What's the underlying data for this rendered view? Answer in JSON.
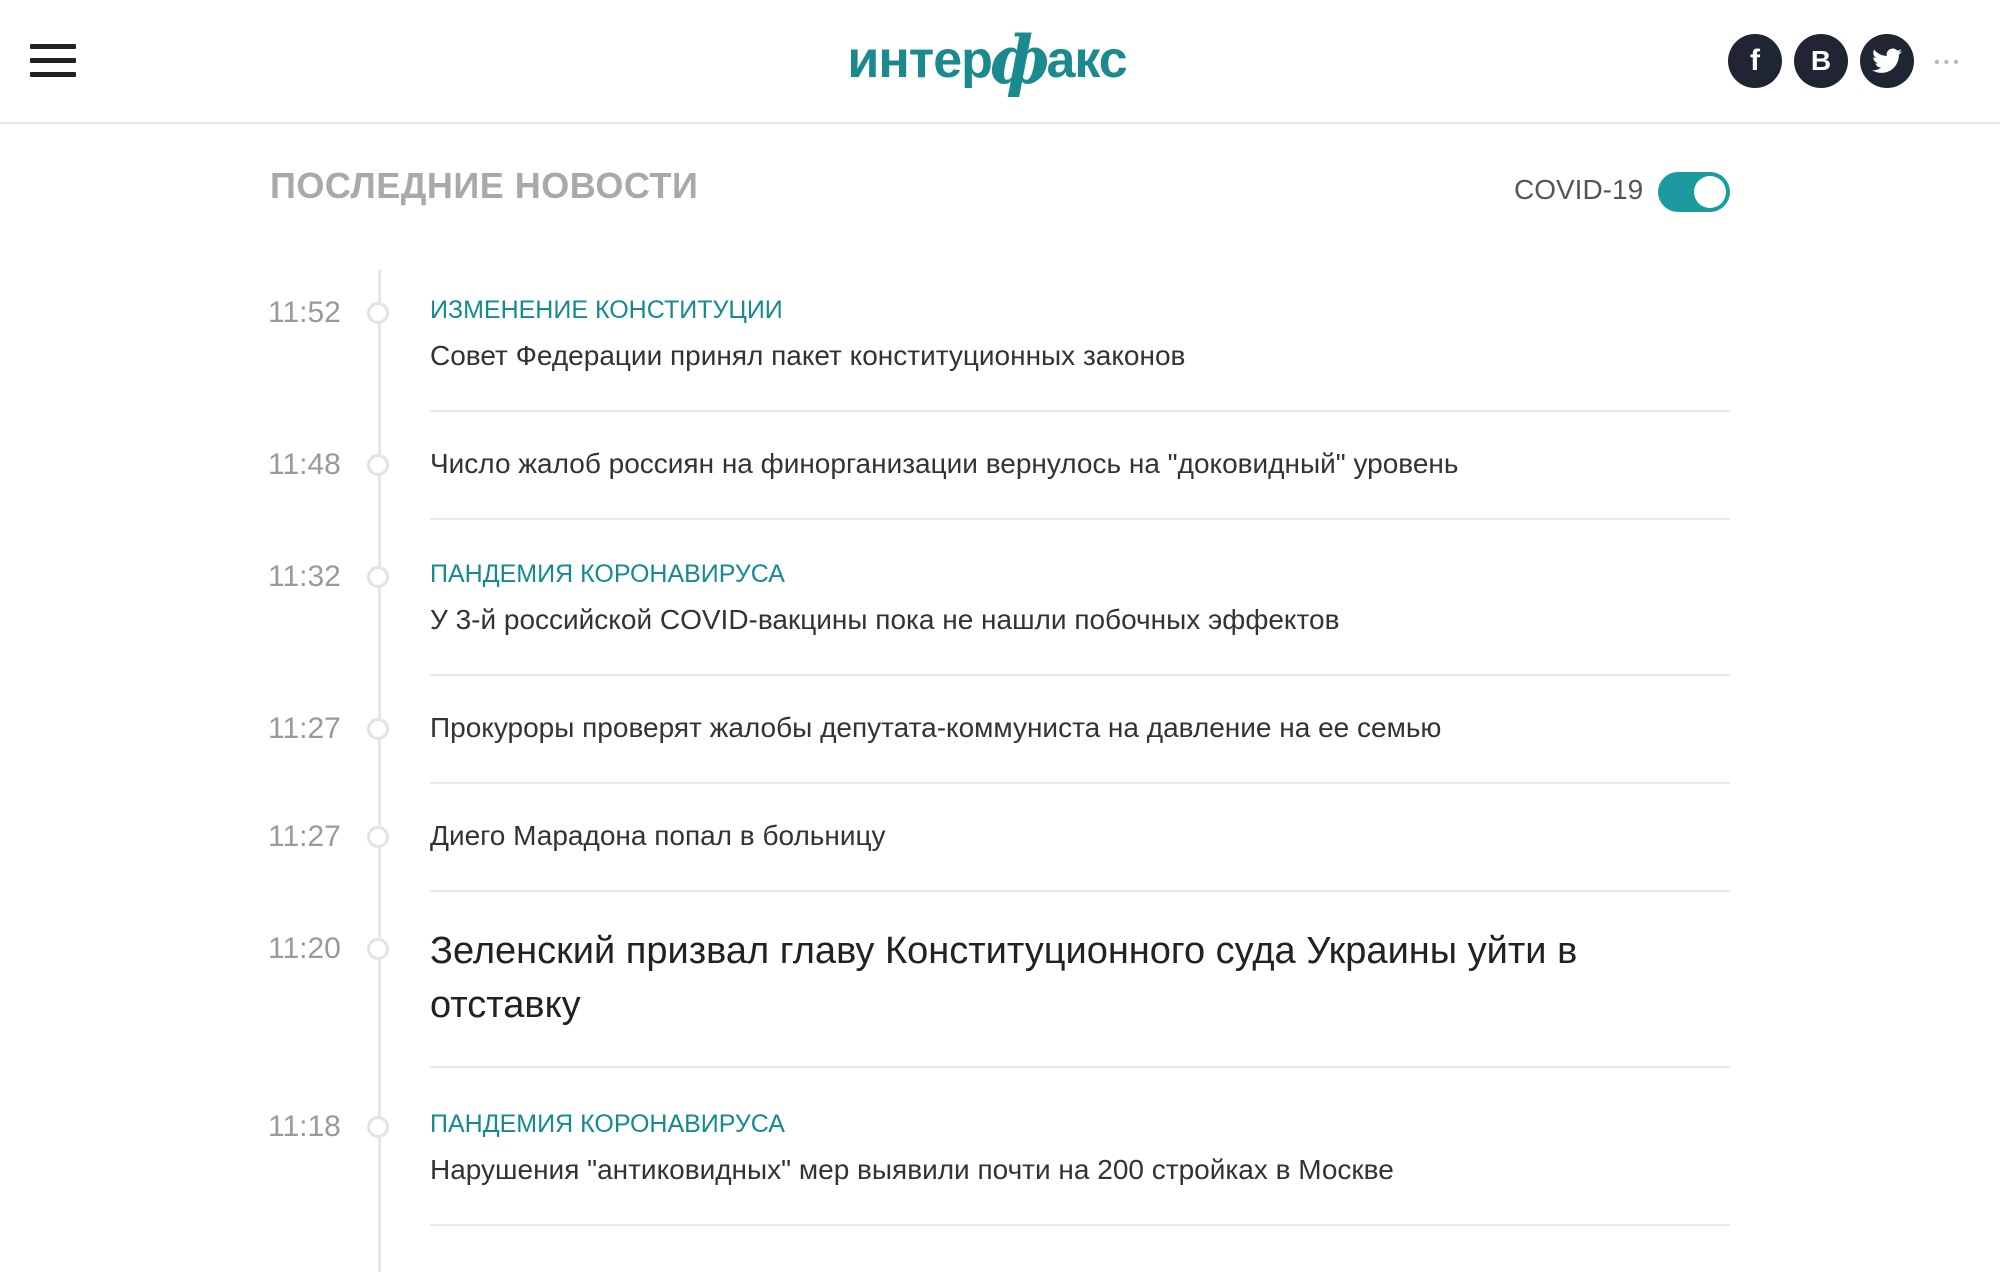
{
  "header": {
    "logo_text": {
      "part1": "интер",
      "part2": "ф",
      "part3": "акс"
    },
    "social": {
      "facebook": "f",
      "vk": "B",
      "twitter_icon": "twitter-bird"
    },
    "more_label": "•••"
  },
  "section": {
    "title": "ПОСЛЕДНИЕ НОВОСТИ",
    "covid_label": "COVID-19",
    "covid_toggle_on": true
  },
  "colors": {
    "accent": "#1b9aa0",
    "rubric": "#148a91",
    "dark_icon": "#1f2533"
  },
  "news": [
    {
      "time": "11:52",
      "rubric": "ИЗМЕНЕНИЕ КОНСТИТУЦИИ",
      "headline": "Совет Федерации принял пакет конституционных законов"
    },
    {
      "time": "11:48",
      "rubric": "",
      "headline": "Число жалоб россиян на финорганизации вернулось на \"доковидный\" уровень"
    },
    {
      "time": "11:32",
      "rubric": "ПАНДЕМИЯ КОРОНАВИРУСА",
      "headline": "У 3-й российской COVID-вакцины пока не нашли побочных эффектов"
    },
    {
      "time": "11:27",
      "rubric": "",
      "headline": "Прокуроры проверят жалобы депутата-коммуниста на давление на ее семью"
    },
    {
      "time": "11:27",
      "rubric": "",
      "headline": "Диего Марадона попал в больницу"
    },
    {
      "time": "11:20",
      "rubric": "",
      "headline": "Зеленский призвал главу Конституционного суда Украины уйти в отставку"
    },
    {
      "time": "11:18",
      "rubric": "ПАНДЕМИЯ КОРОНАВИРУСА",
      "headline": "Нарушения \"антиковидных\" мер выявили почти на 200 стройках в Москве"
    }
  ]
}
